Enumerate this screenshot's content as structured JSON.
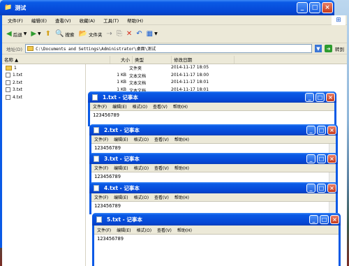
{
  "explorer": {
    "title": "测试",
    "menu": [
      "文件(F)",
      "编辑(E)",
      "查看(V)",
      "收藏(A)",
      "工具(T)",
      "帮助(H)"
    ],
    "toolbar": {
      "back": "后退",
      "search": "搜索",
      "folders": "文件夹"
    },
    "address_label": "地址(D)",
    "address_value": "C:\\Documents and Settings\\Administrator\\桌面\\测试",
    "go_label": "转到",
    "columns": {
      "name": "名称 ▲",
      "size": "大小",
      "type": "类型",
      "modified": "修改日期"
    },
    "left_items": [
      "1",
      "1.txt",
      "2.txt",
      "3.txt",
      "4.txt"
    ],
    "rows": [
      {
        "size": "",
        "type": "文件夹",
        "date": "2014-11-17 18:05"
      },
      {
        "size": "1 KB",
        "type": "文本文档",
        "date": "2014-11-17 18:00"
      },
      {
        "size": "1 KB",
        "type": "文本文档",
        "date": "2014-11-17 18:01"
      },
      {
        "size": "1 KB",
        "type": "文本文档",
        "date": "2014-11-17 18:01"
      }
    ]
  },
  "notepad_menu": [
    "文件(F)",
    "编辑(E)",
    "格式(O)",
    "查看(V)",
    "帮助(H)"
  ],
  "notepads": [
    {
      "title": "1.txt - 记事本",
      "text": "123456789"
    },
    {
      "title": "2.txt - 记事本",
      "text": "123456789"
    },
    {
      "title": "3.txt - 记事本",
      "text": "123456789"
    },
    {
      "title": "4.txt - 记事本",
      "text": "123456789"
    },
    {
      "title": "5.txt - 记事本",
      "text": "123456789"
    }
  ],
  "colors": {
    "xp_blue": "#0a5ae6",
    "chrome": "#ece9d8",
    "close_red": "#c63b1b"
  }
}
